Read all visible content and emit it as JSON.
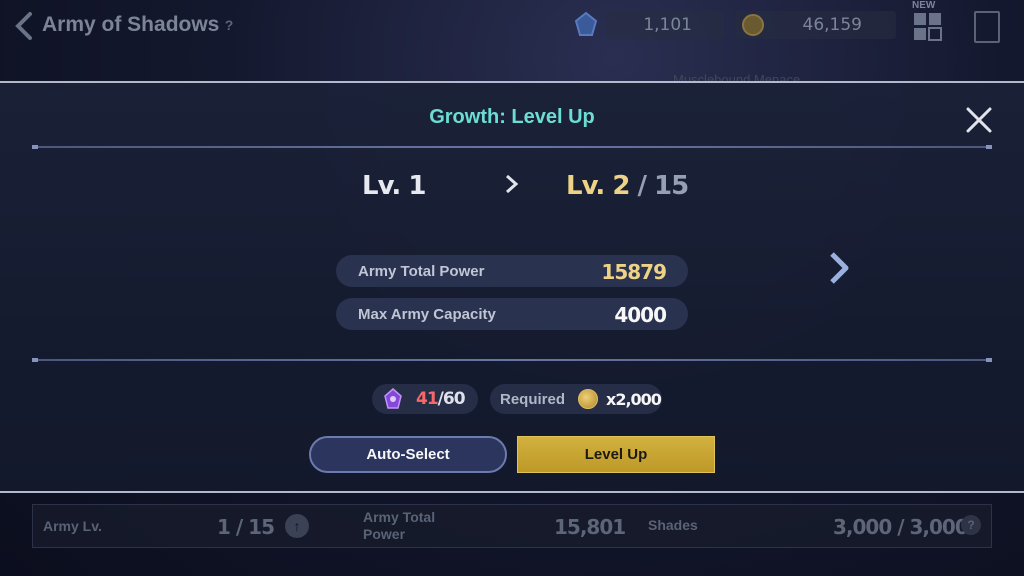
{
  "header": {
    "title": "Army of Shadows",
    "help": "?",
    "resource_gems": "1,101",
    "resource_gold": "46,159",
    "new_badge": "NEW"
  },
  "background": {
    "enemy_name": "Musclebound Menace"
  },
  "modal": {
    "title": "Growth: Level Up",
    "current_level": "Lv. 1",
    "next_level": "Lv. 2",
    "max_level": " / 15",
    "stats": [
      {
        "label": "Army Total Power",
        "value": "15879"
      },
      {
        "label": "Max Army Capacity",
        "value": "4000"
      }
    ],
    "shards_have": "41",
    "shards_need": "/60",
    "required_label": "Required",
    "required_amount": "x2,000",
    "auto_select_label": "Auto-Select",
    "level_up_label": "Level Up"
  },
  "footer": {
    "army_lv_label": "Army Lv.",
    "army_lv_value": "1 / 15",
    "army_power_label": "Army Total Power",
    "army_power_value": "15,801",
    "shades_label": "Shades",
    "shades_value": "3,000 / 3,000",
    "help": "?"
  },
  "colors": {
    "title_accent": "#6fe3d8",
    "gold": "#f5d98a",
    "shard_red": "#ff6b6b",
    "level_up_button": "#d8b640"
  }
}
